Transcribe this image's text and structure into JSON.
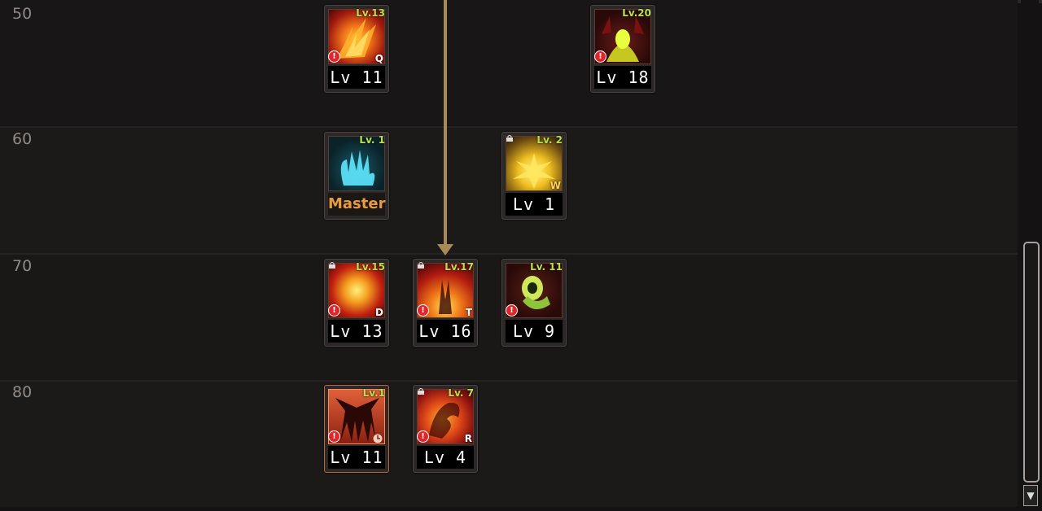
{
  "rows": [
    {
      "label": "50"
    },
    {
      "label": "60"
    },
    {
      "label": "70"
    },
    {
      "label": "80"
    }
  ],
  "skills": {
    "s50a": {
      "req": "Lv.13",
      "level": "Lv 11",
      "key": "Q",
      "icon": "fire-claw-icon"
    },
    "s50b": {
      "req": "Lv.20",
      "level": "Lv 18",
      "icon": "green-demon-icon"
    },
    "s60a": {
      "req": "Lv. 1",
      "level": "Master",
      "icon": "blue-hand-icon"
    },
    "s60b": {
      "req": "Lv. 2",
      "level": "Lv 1",
      "key": "W",
      "icon": "golden-burst-icon"
    },
    "s70a": {
      "req": "Lv.15",
      "level": "Lv 13",
      "key": "D",
      "icon": "fire-explosion-icon"
    },
    "s70b": {
      "req": "Lv.17",
      "level": "Lv 16",
      "key": "T",
      "icon": "fire-pillar-icon"
    },
    "s70c": {
      "req": "Lv. 11",
      "level": "Lv 9",
      "icon": "green-fist-icon"
    },
    "s80a": {
      "req": "Lv.1",
      "level": "Lv 11",
      "icon": "dark-beast-icon"
    },
    "s80b": {
      "req": "Lv. 7",
      "level": "Lv 4",
      "key": "R",
      "icon": "fire-dragon-icon"
    }
  },
  "colors": {
    "level_text": "#ffffff",
    "master_text": "#e89a42",
    "req_text": "#b8e04a",
    "arrow": "#a8895a",
    "alert": "#e0262a"
  }
}
